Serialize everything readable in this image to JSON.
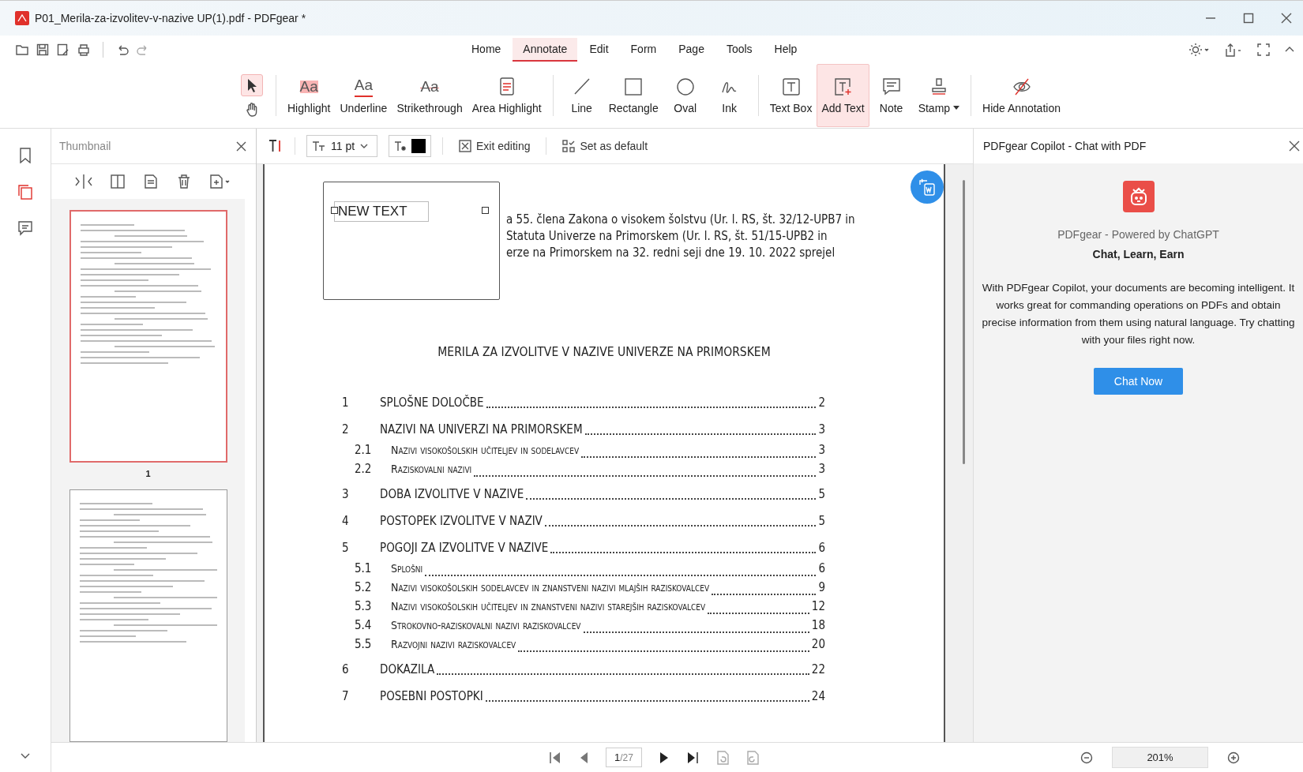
{
  "window": {
    "title": "P01_Merila-za-izvolitev-v-nazive UP(1).pdf - PDFgear *"
  },
  "menu": [
    {
      "label": "Home",
      "selected": false
    },
    {
      "label": "Annotate",
      "selected": true
    },
    {
      "label": "Edit",
      "selected": false
    },
    {
      "label": "Form",
      "selected": false
    },
    {
      "label": "Page",
      "selected": false
    },
    {
      "label": "Tools",
      "selected": false
    },
    {
      "label": "Help",
      "selected": false
    }
  ],
  "select_tool": {
    "selected": true
  },
  "tools": [
    {
      "label": "Highlight",
      "glyph": "Aa",
      "selected": false
    },
    {
      "label": "Underline",
      "glyph": "Aa",
      "selected": false
    },
    {
      "label": "Strikethrough",
      "glyph": "Aa",
      "selected": false
    },
    {
      "label": "Area Highlight",
      "selected": false
    },
    {
      "label": "Line",
      "selected": false
    },
    {
      "label": "Rectangle",
      "selected": false
    },
    {
      "label": "Oval",
      "selected": false
    },
    {
      "label": "Ink",
      "selected": false
    },
    {
      "label": "Text Box",
      "selected": false
    },
    {
      "label": "Add Text",
      "selected": true
    },
    {
      "label": "Note",
      "selected": false
    },
    {
      "label": "Stamp",
      "selected": false
    },
    {
      "label": "Hide Annotation",
      "selected": false
    }
  ],
  "edit_bar": {
    "font_size": "11 pt",
    "exit": "Exit editing",
    "set_default": "Set as default"
  },
  "thumbnail_panel": {
    "title": "Thumbnail",
    "pages": [
      {
        "label": "1",
        "selected": true
      },
      {
        "selected": false
      }
    ]
  },
  "document": {
    "text_box": "NEW TEXT",
    "intro_lines": [
      "a 55. člena Zakona o visokem šolstvu (Ur. l. RS, št. 32/12-UPB7 in",
      "Statuta Univerze na Primorskem (Ur. l. RS, št. 51/15-UPB2 in",
      "erze na Primorskem na 32. redni seji dne 19. 10. 2022 sprejel"
    ],
    "heading": "MERILA ZA IZVOLITVE V NAZIVE UNIVERZE NA PRIMORSKEM",
    "toc": [
      {
        "kind": "chapter",
        "number": "1",
        "title": "SPLOŠNE DOLOČBE",
        "page": "2"
      },
      {
        "kind": "chapter",
        "number": "2",
        "title": "NAZIVI NA UNIVERZI NA PRIMORSKEM",
        "page": "3"
      },
      {
        "kind": "section",
        "number": "2.1",
        "title": "Nazivi visokošolskih učiteljev in sodelavcev",
        "page": "3"
      },
      {
        "kind": "section",
        "number": "2.2",
        "title": "Raziskovalni nazivi",
        "page": "3"
      },
      {
        "kind": "chapter",
        "number": "3",
        "title": "DOBA IZVOLITVE V NAZIVE",
        "page": "5"
      },
      {
        "kind": "chapter",
        "number": "4",
        "title": "POSTOPEK IZVOLITVE V NAZIV",
        "page": "5"
      },
      {
        "kind": "chapter",
        "number": "5",
        "title": "POGOJI ZA IZVOLITVE V NAZIVE",
        "page": "6"
      },
      {
        "kind": "section",
        "number": "5.1",
        "title": "Splošni",
        "page": "6"
      },
      {
        "kind": "section",
        "number": "5.2",
        "title": "Nazivi visokošolskih sodelavcev in znanstveni nazivi mlajših raziskovalcev",
        "page": "9"
      },
      {
        "kind": "section",
        "number": "5.3",
        "title": "Nazivi visokošolskih učiteljev in znanstveni nazivi starejših raziskovalcev",
        "page": "12"
      },
      {
        "kind": "section",
        "number": "5.4",
        "title": "Strokovno-raziskovalni nazivi raziskovalcev",
        "page": "18"
      },
      {
        "kind": "section",
        "number": "5.5",
        "title": "Razvojni nazivi raziskovalcev",
        "page": "20"
      },
      {
        "kind": "chapter",
        "number": "6",
        "title": "DOKAZILA",
        "page": "22"
      },
      {
        "kind": "chapter",
        "number": "7",
        "title": "POSEBNI POSTOPKI",
        "page": "24"
      }
    ]
  },
  "copilot": {
    "title": "PDFgear Copilot - Chat with PDF",
    "subtitle": "PDFgear - Powered by ChatGPT",
    "tagline": "Chat, Learn, Earn",
    "description": "With PDFgear Copilot, your documents are becoming intelligent. It works great for commanding operations on PDFs and obtain precise information from them using natural language. Try chatting with your files right now.",
    "button": "Chat Now"
  },
  "status_bar": {
    "page": "1",
    "page_count": "/27",
    "zoom": "201%"
  }
}
